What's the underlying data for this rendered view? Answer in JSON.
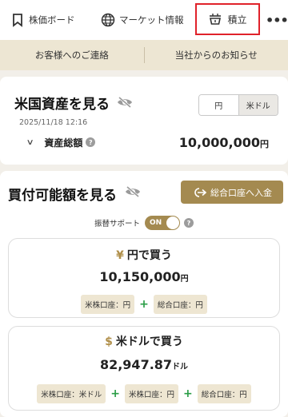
{
  "nav": {
    "board_label": "株価ボード",
    "market_label": "マーケット情報",
    "tsumitate_label": "積立",
    "more_label": "•••"
  },
  "infobar": {
    "contact_label": "お客様へのご連絡",
    "notice_label": "当社からのお知らせ"
  },
  "us_assets": {
    "title": "米国資産を見る",
    "currency_jpy": "円",
    "currency_usd": "米ドル",
    "datetime": "2025/11/18 12:16",
    "total_label": "資産総額",
    "total_value": "10,000,000",
    "total_unit": "円"
  },
  "buying_power": {
    "title": "買付可能額を見る",
    "deposit_button": "総合口座へ入金",
    "transfer_label": "振替サポート",
    "transfer_toggle": "ON",
    "jpy": {
      "currency_symbol": "¥",
      "title": "円で買う",
      "amount": "10,150,000",
      "unit": "円",
      "chip1": "米株口座：円",
      "chip2": "総合口座：円"
    },
    "usd": {
      "currency_symbol": "$",
      "title": "米ドルで買う",
      "amount": "82,947.87",
      "unit": "ドル",
      "chip1": "米株口座：米ドル",
      "chip2": "米株口座：円",
      "chip3": "総合口座：円"
    }
  },
  "colors": {
    "accent_gold": "#a48a50",
    "highlight_red": "#e0222a",
    "plus_green": "#2a9d46"
  }
}
